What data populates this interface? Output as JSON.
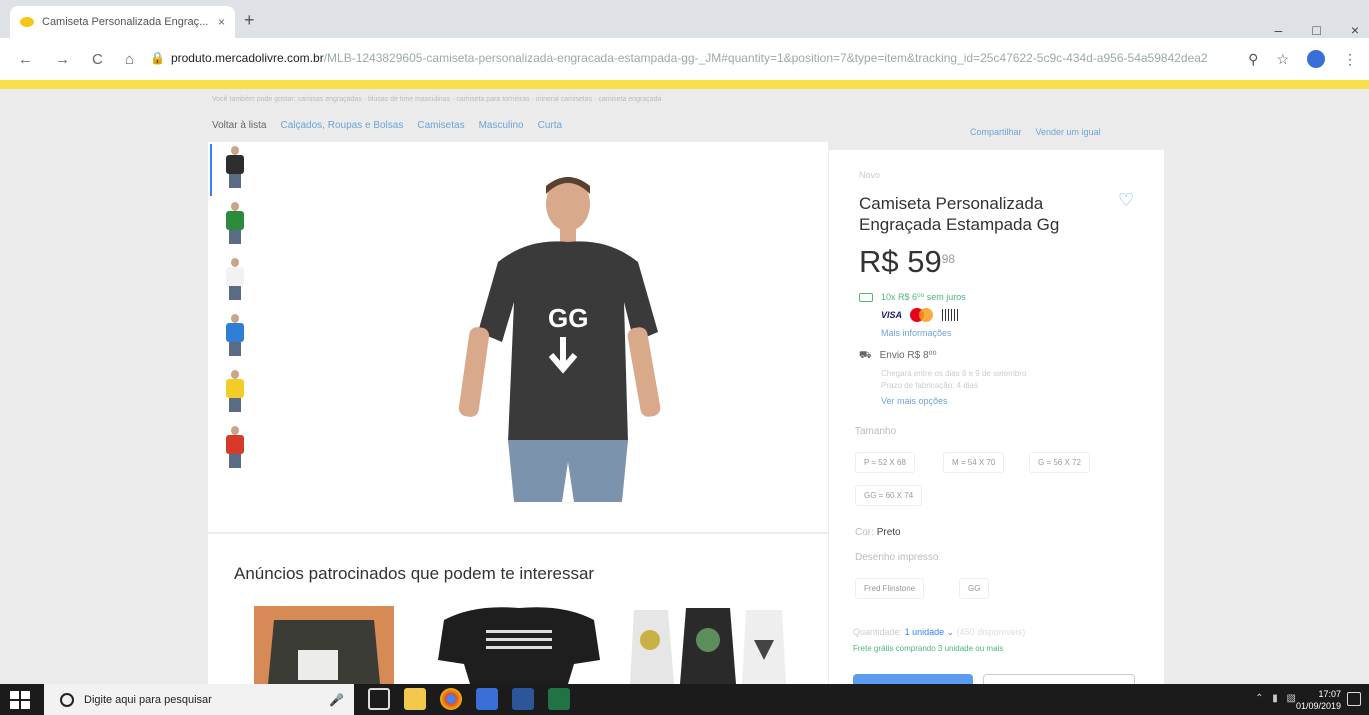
{
  "browser": {
    "tab_title": "Camiseta Personalizada Engraç...",
    "tab_close": "×",
    "new_tab": "+",
    "url_domain": "produto.mercadolivre.com.br",
    "url_path": "/MLB-1243829605-camiseta-personalizada-engracada-estampada-gg-_JM#quantity=1&position=7&type=item&tracking_id=25c47622-5c9c-434d-a956-54a59842dea2",
    "nav_back": "←",
    "nav_forward": "→",
    "nav_reload": "C",
    "nav_home": "⌂",
    "win_min": "–",
    "win_max": "□",
    "win_close": "×",
    "accent": "#f7e04c"
  },
  "page": {
    "related_searches": "Você também pode gostar: camisas engraçadas · blusas de time masculinas · camiseta para torneiras · mineral camisetas · camiseta engraçada",
    "back_to_list": "Voltar à lista",
    "breadcrumb": [
      "Calçados, Roupas e Bolsas",
      "Camisetas",
      "Masculino",
      "Curta"
    ],
    "share": "Compartilhar",
    "sell_one": "Vender um igual",
    "thumb_colors": [
      "#2d2d2d",
      "#2e8b3e",
      "#f2f2f2",
      "#2f7fd6",
      "#f2cd28",
      "#d83a2a"
    ],
    "shirt_text": "GG",
    "sponsored_title": "Anúncios patrocinados que podem te interessar"
  },
  "product": {
    "condition": "Novo",
    "title": "Camiseta Personalizada Engraçada Estampada Gg",
    "price_main": "R$ 59",
    "price_cents": "98",
    "installments": "10x R$ 6⁰⁰ sem juros",
    "card_visa": "VISA",
    "more_info": "Mais informações",
    "shipping": "Envio R$ 8⁰⁰",
    "shipping_detail_1": "Chegará entre os dias 6 e 9 de setembro",
    "shipping_detail_2": "Prazo de fabricação: 4 dias",
    "shipping_more": "Ver mais opções",
    "size_label": "Tamanho",
    "sizes": [
      "P = 52 X 68",
      "M = 54 X 70",
      "G = 56 X 72",
      "GG = 60 X 74"
    ],
    "color_label": "Cor:",
    "color_value": "Preto",
    "design_label": "Desenho impresso",
    "designs": [
      "Fred Flinstone",
      "GG"
    ],
    "quantity_label": "Quantidade:",
    "quantity_value": "1 unidade",
    "quantity_chevron": "⌄",
    "quantity_available": "(450 disponíveis)",
    "free_shipping": "Frete grátis comprando 3 unidade ou mais"
  },
  "taskbar": {
    "search_placeholder": "Digite aqui para pesquisar",
    "time": "17:07",
    "date": "01/09/2019"
  }
}
